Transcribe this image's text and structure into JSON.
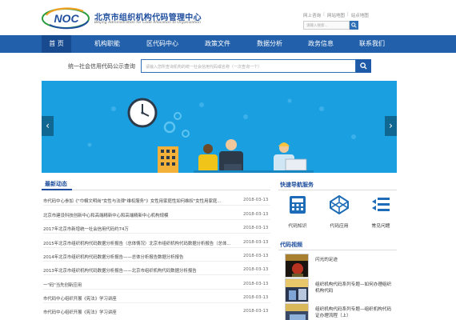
{
  "header": {
    "logo_text": "NOC",
    "title": "北京市组织机构代码管理中心",
    "subtitle": "Beijing Administration for Code Allocation to Organization",
    "toplinks": [
      "网上咨询",
      "网站地图",
      "站点地图"
    ],
    "search_placeholder": "请输入搜索..."
  },
  "nav": {
    "items": [
      "首 页",
      "机构职能",
      "区代码中心",
      "政策文件",
      "数据分析",
      "政务信息",
      "联系我们"
    ]
  },
  "credit_search": {
    "label": "统一社会信用代码公示查询",
    "placeholder": "请输入您所查询机构的统一社会信用代码或名称（一次查询一个）"
  },
  "banner": {
    "left_arrow": "‹",
    "right_arrow": "›"
  },
  "news": {
    "title": "最新动态",
    "items": [
      {
        "title": "市代码中心参加《\"巾帼文明岗\"女性与法律\"维权服务\"》女性用家庭性如何维权\"女性用家庭...",
        "date": "2018-03-13"
      },
      {
        "title": "北京市建设科技创新中心和高端精新中心和高端精新中心机构规模",
        "date": "2018-03-13"
      },
      {
        "title": "2017年北京市新增统一社会信用代码约74万",
        "date": "2018-03-13"
      },
      {
        "title": "2015年北京市组织机构代码数据分析报告（总体情况）北京市组织机构代码数据分析报告（总体...",
        "date": "2018-03-13"
      },
      {
        "title": "2014年北京市组织机构代码数据分析报告——总体分析报告数据分析报告",
        "date": "2018-03-13"
      },
      {
        "title": "2013年北京市组织机构代码数据分析报告——北京市组织机构代码数据分析报告",
        "date": "2018-03-13"
      },
      {
        "title": "一\"码\"当先创新应用",
        "date": "2018-03-13"
      },
      {
        "title": "市代码中心组织开展《宪法》学习讲座",
        "date": "2018-03-13"
      },
      {
        "title": "市代码中心组织开展《宪法》学习讲座",
        "date": "2018-03-13"
      }
    ]
  },
  "quick_nav": {
    "title": "快速导航服务",
    "items": [
      {
        "label": "代码知识",
        "icon": "calculator-icon"
      },
      {
        "label": "代码应用",
        "icon": "codepen-icon"
      },
      {
        "label": "常见问题",
        "icon": "list-arrows-icon"
      }
    ]
  },
  "code_video": {
    "title": "代码视频",
    "items": [
      {
        "text": "闪光的足迹"
      },
      {
        "text": "组织机构代码系列专题—如何办理组织机构代码"
      },
      {
        "text": "组织机构代码系列专题—组织机构代码证办理流程（上）"
      }
    ]
  },
  "colors": {
    "brand_blue": "#2260ab",
    "banner_blue": "#1a9fe0",
    "title_blue": "#1f4e9e"
  }
}
